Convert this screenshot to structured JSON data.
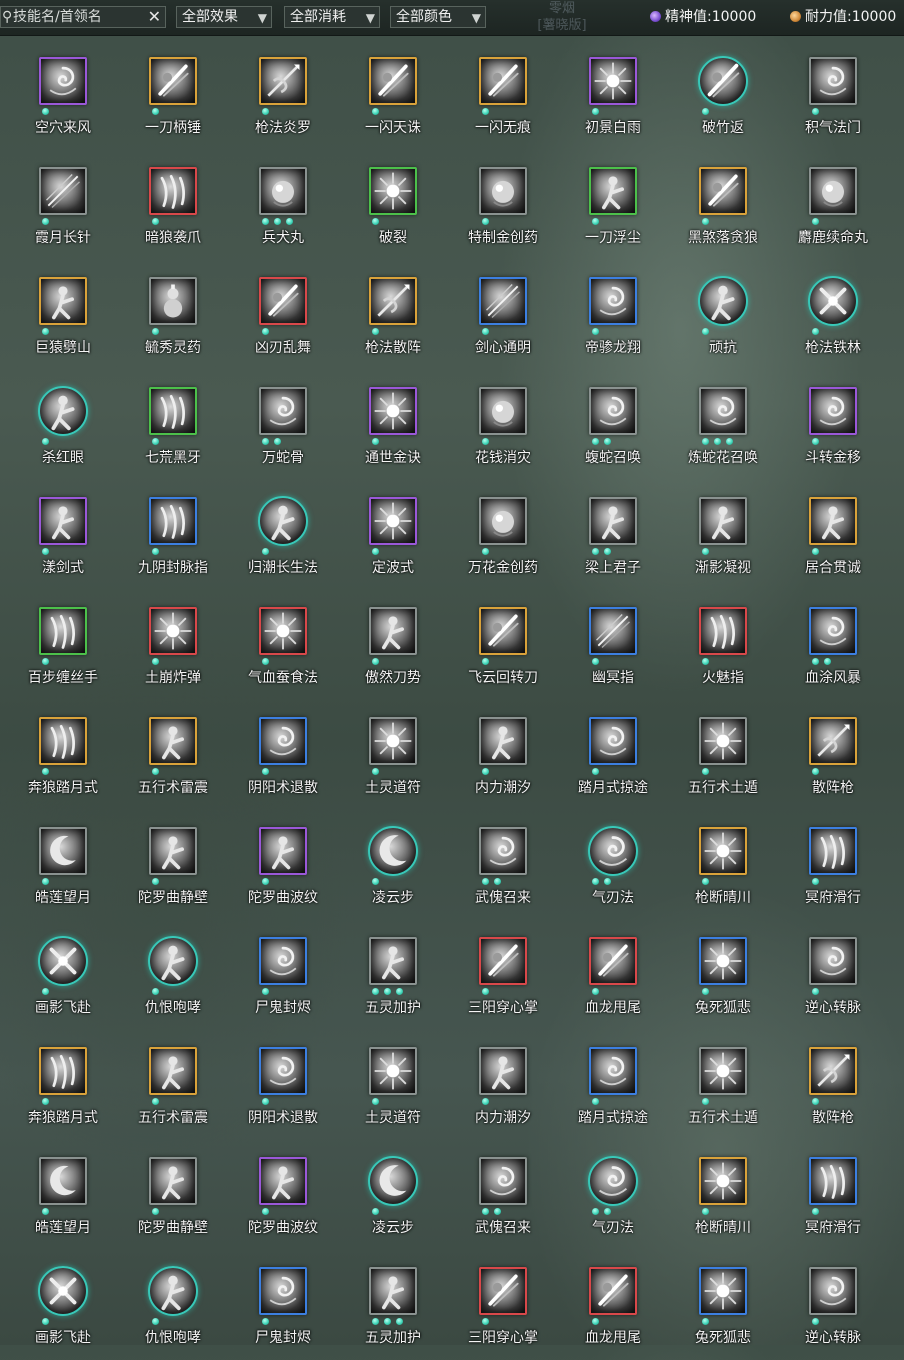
{
  "toolbar": {
    "search_placeholder": "技能名/首领名",
    "search_value": "",
    "clear_icon": "close-icon",
    "filters": [
      {
        "label": "全部效果"
      },
      {
        "label": "全部消耗"
      },
      {
        "label": "全部颜色"
      }
    ],
    "faint_label": "零烟",
    "faint_sub": "[薯晓版]",
    "spirit_label": "精神值:10000",
    "stamina_label": "耐力值:10000"
  },
  "colors": {
    "purple": "#9a58d8",
    "gold": "#d9a23a",
    "green": "#4cc04a",
    "red": "#d8484a",
    "blue": "#3c7fe0",
    "gray": "#8a9290",
    "teal": "#38c8b8",
    "dot": "#3fd6b8"
  },
  "skills": [
    {
      "name": "空穴来风",
      "color": "purple",
      "dots": 1,
      "shape": "square",
      "glyph": "swirl"
    },
    {
      "name": "一刀柄锤",
      "color": "gold",
      "dots": 1,
      "shape": "square",
      "glyph": "slash"
    },
    {
      "name": "枪法炎罗",
      "color": "gold",
      "dots": 1,
      "shape": "square",
      "glyph": "spear"
    },
    {
      "name": "一闪天诛",
      "color": "gold",
      "dots": 1,
      "shape": "square",
      "glyph": "slash"
    },
    {
      "name": "一闪无痕",
      "color": "gold",
      "dots": 1,
      "shape": "square",
      "glyph": "slash"
    },
    {
      "name": "初景白雨",
      "color": "purple",
      "dots": 1,
      "shape": "square",
      "glyph": "burst"
    },
    {
      "name": "破竹返",
      "color": "teal",
      "dots": 1,
      "shape": "round",
      "glyph": "slash"
    },
    {
      "name": "积气法门",
      "color": "gray",
      "dots": 1,
      "shape": "square",
      "glyph": "swirl"
    },
    {
      "name": "霞月长针",
      "color": "gray",
      "dots": 1,
      "shape": "square",
      "glyph": "needle"
    },
    {
      "name": "暗狼袭爪",
      "color": "red",
      "dots": 1,
      "shape": "square",
      "glyph": "claw"
    },
    {
      "name": "兵犬丸",
      "color": "gray",
      "dots": 3,
      "shape": "square",
      "glyph": "orb"
    },
    {
      "name": "破裂",
      "color": "green",
      "dots": 1,
      "shape": "square",
      "glyph": "burst"
    },
    {
      "name": "特制金创药",
      "color": "gray",
      "dots": 1,
      "shape": "square",
      "glyph": "orb"
    },
    {
      "name": "一刀浮尘",
      "color": "green",
      "dots": 1,
      "shape": "square",
      "glyph": "figure"
    },
    {
      "name": "黑煞落贪狼",
      "color": "gold",
      "dots": 1,
      "shape": "square",
      "glyph": "slash"
    },
    {
      "name": "麝鹿续命丸",
      "color": "gray",
      "dots": 1,
      "shape": "square",
      "glyph": "orb"
    },
    {
      "name": "巨猿劈山",
      "color": "gold",
      "dots": 1,
      "shape": "square",
      "glyph": "figure"
    },
    {
      "name": "毓秀灵药",
      "color": "gray",
      "dots": 1,
      "shape": "square",
      "glyph": "gourd"
    },
    {
      "name": "凶刃乱舞",
      "color": "red",
      "dots": 1,
      "shape": "square",
      "glyph": "slash"
    },
    {
      "name": "枪法散阵",
      "color": "gold",
      "dots": 1,
      "shape": "square",
      "glyph": "spear"
    },
    {
      "name": "剑心通明",
      "color": "blue",
      "dots": 1,
      "shape": "square",
      "glyph": "needle"
    },
    {
      "name": "帝骖龙翔",
      "color": "blue",
      "dots": 1,
      "shape": "square",
      "glyph": "swirl"
    },
    {
      "name": "顽抗",
      "color": "teal",
      "dots": 1,
      "shape": "round",
      "glyph": "figure"
    },
    {
      "name": "枪法铁林",
      "color": "teal",
      "dots": 1,
      "shape": "round",
      "glyph": "cross"
    },
    {
      "name": "杀红眼",
      "color": "teal",
      "dots": 1,
      "shape": "round",
      "glyph": "figure"
    },
    {
      "name": "七荒黑牙",
      "color": "green",
      "dots": 1,
      "shape": "square",
      "glyph": "claw"
    },
    {
      "name": "万蛇骨",
      "color": "gray",
      "dots": 2,
      "shape": "square",
      "glyph": "swirl"
    },
    {
      "name": "通世金诀",
      "color": "purple",
      "dots": 1,
      "shape": "square",
      "glyph": "burst"
    },
    {
      "name": "花钱消灾",
      "color": "gray",
      "dots": 1,
      "shape": "square",
      "glyph": "orb"
    },
    {
      "name": "蝮蛇召唤",
      "color": "gray",
      "dots": 2,
      "shape": "square",
      "glyph": "swirl"
    },
    {
      "name": "炼蛇花召唤",
      "color": "gray",
      "dots": 3,
      "shape": "square",
      "glyph": "swirl"
    },
    {
      "name": "斗转金移",
      "color": "purple",
      "dots": 1,
      "shape": "square",
      "glyph": "swirl"
    },
    {
      "name": "漾剑式",
      "color": "purple",
      "dots": 1,
      "shape": "square",
      "glyph": "figure"
    },
    {
      "name": "九阴封脉指",
      "color": "blue",
      "dots": 1,
      "shape": "square",
      "glyph": "claw"
    },
    {
      "name": "归潮长生法",
      "color": "teal",
      "dots": 1,
      "shape": "round",
      "glyph": "figure"
    },
    {
      "name": "定波式",
      "color": "purple",
      "dots": 1,
      "shape": "square",
      "glyph": "burst"
    },
    {
      "name": "万花金创药",
      "color": "gray",
      "dots": 1,
      "shape": "square",
      "glyph": "orb"
    },
    {
      "name": "梁上君子",
      "color": "gray",
      "dots": 2,
      "shape": "square",
      "glyph": "figure"
    },
    {
      "name": "渐影凝视",
      "color": "gray",
      "dots": 1,
      "shape": "square",
      "glyph": "figure"
    },
    {
      "name": "居合贯诚",
      "color": "gold",
      "dots": 1,
      "shape": "square",
      "glyph": "figure"
    },
    {
      "name": "百步缠丝手",
      "color": "green",
      "dots": 1,
      "shape": "square",
      "glyph": "claw"
    },
    {
      "name": "土崩炸弹",
      "color": "red",
      "dots": 1,
      "shape": "square",
      "glyph": "burst"
    },
    {
      "name": "气血蚕食法",
      "color": "red",
      "dots": 1,
      "shape": "square",
      "glyph": "burst"
    },
    {
      "name": "傲然刀势",
      "color": "gray",
      "dots": 1,
      "shape": "square",
      "glyph": "figure"
    },
    {
      "name": "飞云回转刀",
      "color": "gold",
      "dots": 1,
      "shape": "square",
      "glyph": "slash"
    },
    {
      "name": "幽冥指",
      "color": "blue",
      "dots": 1,
      "shape": "square",
      "glyph": "needle"
    },
    {
      "name": "火魅指",
      "color": "red",
      "dots": 1,
      "shape": "square",
      "glyph": "claw"
    },
    {
      "name": "血涂风暴",
      "color": "blue",
      "dots": 2,
      "shape": "square",
      "glyph": "swirl"
    },
    {
      "name": "奔狼踏月式",
      "color": "gold",
      "dots": 1,
      "shape": "square",
      "glyph": "claw"
    },
    {
      "name": "五行术雷震",
      "color": "gold",
      "dots": 1,
      "shape": "square",
      "glyph": "figure"
    },
    {
      "name": "阴阳术退散",
      "color": "blue",
      "dots": 1,
      "shape": "square",
      "glyph": "swirl"
    },
    {
      "name": "土灵道符",
      "color": "gray",
      "dots": 1,
      "shape": "square",
      "glyph": "burst"
    },
    {
      "name": "内力潮汐",
      "color": "gray",
      "dots": 1,
      "shape": "square",
      "glyph": "figure"
    },
    {
      "name": "踏月式掠途",
      "color": "blue",
      "dots": 1,
      "shape": "square",
      "glyph": "swirl"
    },
    {
      "name": "五行术土遁",
      "color": "gray",
      "dots": 1,
      "shape": "square",
      "glyph": "burst"
    },
    {
      "name": "散阵枪",
      "color": "gold",
      "dots": 1,
      "shape": "square",
      "glyph": "spear"
    },
    {
      "name": "皓莲望月",
      "color": "gray",
      "dots": 1,
      "shape": "square",
      "glyph": "moon"
    },
    {
      "name": "陀罗曲静壁",
      "color": "gray",
      "dots": 1,
      "shape": "square",
      "glyph": "figure"
    },
    {
      "name": "陀罗曲波纹",
      "color": "purple",
      "dots": 1,
      "shape": "square",
      "glyph": "figure"
    },
    {
      "name": "凌云步",
      "color": "teal",
      "dots": 1,
      "shape": "round",
      "glyph": "moon"
    },
    {
      "name": "武傀召来",
      "color": "gray",
      "dots": 2,
      "shape": "square",
      "glyph": "swirl"
    },
    {
      "name": "气刃法",
      "color": "teal",
      "dots": 2,
      "shape": "round",
      "glyph": "swirl"
    },
    {
      "name": "枪断晴川",
      "color": "gold",
      "dots": 1,
      "shape": "square",
      "glyph": "burst"
    },
    {
      "name": "冥府滑行",
      "color": "blue",
      "dots": 1,
      "shape": "square",
      "glyph": "claw"
    },
    {
      "name": "画影飞赴",
      "color": "teal",
      "dots": 1,
      "shape": "round",
      "glyph": "cross"
    },
    {
      "name": "仇恨咆哮",
      "color": "teal",
      "dots": 1,
      "shape": "round",
      "glyph": "figure"
    },
    {
      "name": "尸鬼封烬",
      "color": "blue",
      "dots": 1,
      "shape": "square",
      "glyph": "swirl"
    },
    {
      "name": "五灵加护",
      "color": "gray",
      "dots": 3,
      "shape": "square",
      "glyph": "figure"
    },
    {
      "name": "三阳穿心掌",
      "color": "red",
      "dots": 1,
      "shape": "square",
      "glyph": "slash"
    },
    {
      "name": "血龙甩尾",
      "color": "red",
      "dots": 1,
      "shape": "square",
      "glyph": "slash"
    },
    {
      "name": "兔死狐悲",
      "color": "blue",
      "dots": 1,
      "shape": "square",
      "glyph": "burst"
    },
    {
      "name": "逆心转脉",
      "color": "gray",
      "dots": 1,
      "shape": "square",
      "glyph": "swirl"
    },
    {
      "name": "奔狼踏月式",
      "color": "gold",
      "dots": 1,
      "shape": "square",
      "glyph": "claw"
    },
    {
      "name": "五行术雷震",
      "color": "gold",
      "dots": 1,
      "shape": "square",
      "glyph": "figure"
    },
    {
      "name": "阴阳术退散",
      "color": "blue",
      "dots": 1,
      "shape": "square",
      "glyph": "swirl"
    },
    {
      "name": "土灵道符",
      "color": "gray",
      "dots": 1,
      "shape": "square",
      "glyph": "burst"
    },
    {
      "name": "内力潮汐",
      "color": "gray",
      "dots": 1,
      "shape": "square",
      "glyph": "figure"
    },
    {
      "name": "踏月式掠途",
      "color": "blue",
      "dots": 1,
      "shape": "square",
      "glyph": "swirl"
    },
    {
      "name": "五行术土遁",
      "color": "gray",
      "dots": 1,
      "shape": "square",
      "glyph": "burst"
    },
    {
      "name": "散阵枪",
      "color": "gold",
      "dots": 1,
      "shape": "square",
      "glyph": "spear"
    },
    {
      "name": "皓莲望月",
      "color": "gray",
      "dots": 1,
      "shape": "square",
      "glyph": "moon"
    },
    {
      "name": "陀罗曲静壁",
      "color": "gray",
      "dots": 1,
      "shape": "square",
      "glyph": "figure"
    },
    {
      "name": "陀罗曲波纹",
      "color": "purple",
      "dots": 1,
      "shape": "square",
      "glyph": "figure"
    },
    {
      "name": "凌云步",
      "color": "teal",
      "dots": 1,
      "shape": "round",
      "glyph": "moon"
    },
    {
      "name": "武傀召来",
      "color": "gray",
      "dots": 2,
      "shape": "square",
      "glyph": "swirl"
    },
    {
      "name": "气刃法",
      "color": "teal",
      "dots": 2,
      "shape": "round",
      "glyph": "swirl"
    },
    {
      "name": "枪断晴川",
      "color": "gold",
      "dots": 1,
      "shape": "square",
      "glyph": "burst"
    },
    {
      "name": "冥府滑行",
      "color": "blue",
      "dots": 1,
      "shape": "square",
      "glyph": "claw"
    },
    {
      "name": "画影飞赴",
      "color": "teal",
      "dots": 1,
      "shape": "round",
      "glyph": "cross"
    },
    {
      "name": "仇恨咆哮",
      "color": "teal",
      "dots": 1,
      "shape": "round",
      "glyph": "figure"
    },
    {
      "name": "尸鬼封烬",
      "color": "blue",
      "dots": 1,
      "shape": "square",
      "glyph": "swirl"
    },
    {
      "name": "五灵加护",
      "color": "gray",
      "dots": 3,
      "shape": "square",
      "glyph": "figure"
    },
    {
      "name": "三阳穿心掌",
      "color": "red",
      "dots": 1,
      "shape": "square",
      "glyph": "slash"
    },
    {
      "name": "血龙甩尾",
      "color": "red",
      "dots": 1,
      "shape": "square",
      "glyph": "slash"
    },
    {
      "name": "兔死狐悲",
      "color": "blue",
      "dots": 1,
      "shape": "square",
      "glyph": "burst"
    },
    {
      "name": "逆心转脉",
      "color": "gray",
      "dots": 1,
      "shape": "square",
      "glyph": "swirl"
    }
  ]
}
